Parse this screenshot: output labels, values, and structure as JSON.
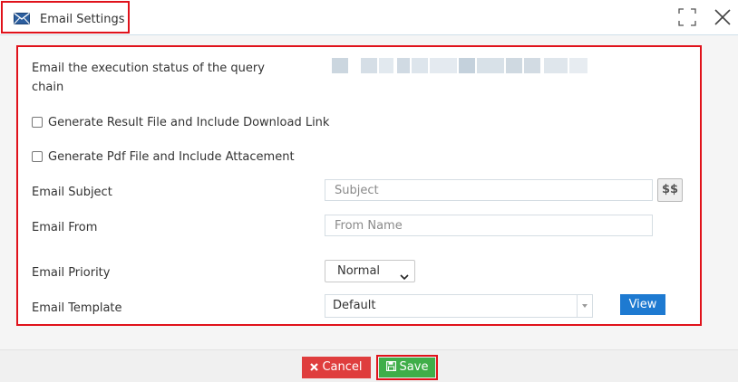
{
  "window": {
    "title": "Email Settings",
    "icon": "mail-icon",
    "controls": [
      "maximize-icon",
      "close-icon"
    ]
  },
  "form": {
    "status_label": "Email the execution status of the query chain",
    "status_value_blurred": true,
    "checkbox_result": {
      "label": "Generate Result File and Include Download Link",
      "checked": false
    },
    "checkbox_pdf": {
      "label": "Generate Pdf File and Include Attacement",
      "checked": false
    },
    "subject": {
      "label": "Email Subject",
      "placeholder": "Subject",
      "value": "",
      "variables_button": "$$"
    },
    "from": {
      "label": "Email From",
      "placeholder": "From Name",
      "value": ""
    },
    "priority": {
      "label": "Email Priority",
      "selected": "Normal"
    },
    "template": {
      "label": "Email Template",
      "selected": "Default",
      "view_button": "View"
    }
  },
  "footer": {
    "cancel_label": "Cancel",
    "save_label": "Save"
  },
  "colors": {
    "highlight": "#e0121b",
    "cancel": "#df3d3d",
    "save": "#3fae49",
    "view": "#1e7ad1",
    "mail_icon": "#2c5e9e"
  }
}
